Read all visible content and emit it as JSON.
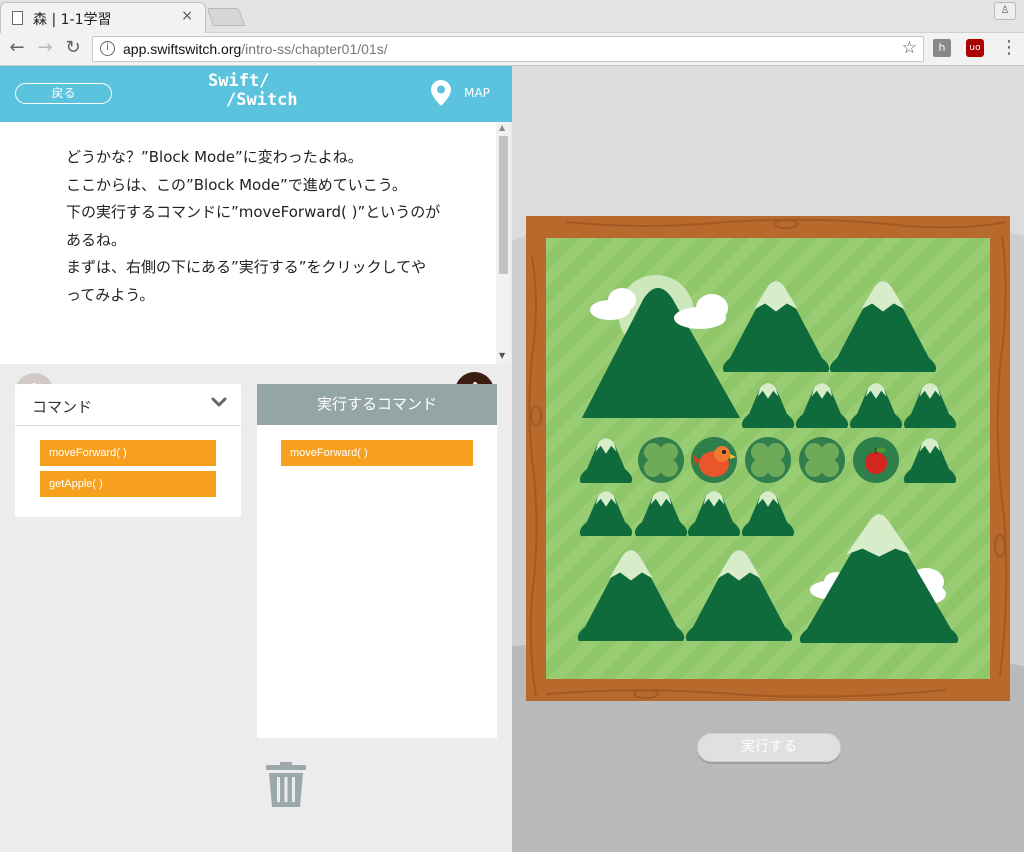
{
  "browser": {
    "tab_title": "森 | 1-1学習",
    "tab_close": "×",
    "profile": "♙",
    "back": "←",
    "forward": "→",
    "reload": "↻",
    "info": "i",
    "url_host": "app.swiftswitch.org",
    "url_path": "/intro-ss/chapter01/01s/",
    "bookmark": "☆",
    "ext1": "h",
    "ext2": "uo",
    "menu": "⋮"
  },
  "header": {
    "back_label": "戻る",
    "logo_line1": "Swift/",
    "logo_line2": "/Switch",
    "map_label": "MAP"
  },
  "story": {
    "lines": [
      "どうかな？”Block Mode”に変わったよね。",
      "ここからは、この”Block Mode”で進めていこう。",
      "下の実行するコマンドに”moveForward( )”というのが",
      "あるね。",
      "まずは、右側の下にある”実行する”をクリックしてや",
      "ってみよう。"
    ]
  },
  "commands": {
    "header": "コマンド",
    "blocks": [
      "moveForward(  )",
      "getApple(  )"
    ]
  },
  "run_commands": {
    "header": "実行するコマンド",
    "blocks": [
      "moveForward(  )"
    ]
  },
  "game": {
    "run_button": "実行する"
  },
  "colors": {
    "header": "#5bc3de",
    "block": "#f6a01e",
    "frame": "#b86a2c",
    "grass": "#8fc66a",
    "mountain": "#0f6b3c",
    "snow": "#d7ecc8"
  }
}
